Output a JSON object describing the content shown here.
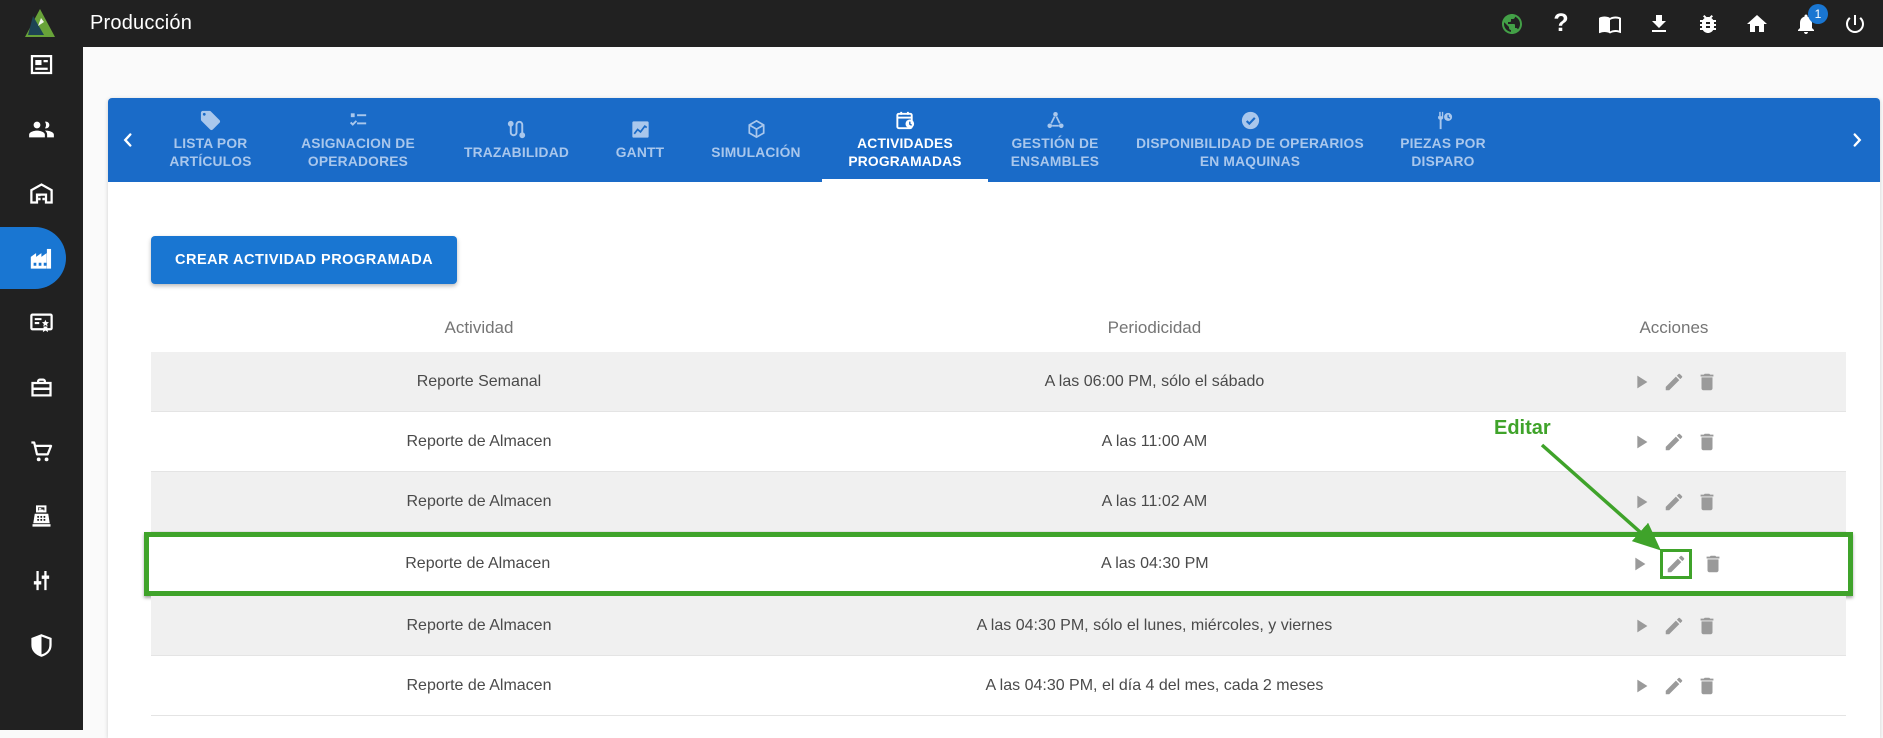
{
  "topbar": {
    "title": "Producción",
    "icons": [
      {
        "name": "globe-icon"
      },
      {
        "name": "help-icon"
      },
      {
        "name": "book-icon"
      },
      {
        "name": "download-icon"
      },
      {
        "name": "bug-icon"
      },
      {
        "name": "home-icon"
      },
      {
        "name": "notifications-icon",
        "badge": "1"
      },
      {
        "name": "power-icon"
      }
    ]
  },
  "sidebar": {
    "items": [
      {
        "name": "news",
        "icon": "newspaper-icon",
        "active": false
      },
      {
        "name": "staff",
        "icon": "people-icon",
        "active": false
      },
      {
        "name": "warehouse",
        "icon": "warehouse-icon",
        "active": false
      },
      {
        "name": "production",
        "icon": "factory-icon",
        "active": true
      },
      {
        "name": "quality",
        "icon": "certificate-icon",
        "active": false
      },
      {
        "name": "assets",
        "icon": "briefcase-icon",
        "active": false
      },
      {
        "name": "purchases",
        "icon": "cart-icon",
        "active": false
      },
      {
        "name": "pos",
        "icon": "cash-register-icon",
        "active": false
      },
      {
        "name": "configuration",
        "icon": "tune-icon",
        "active": false
      },
      {
        "name": "security",
        "icon": "shield-icon",
        "active": false
      }
    ]
  },
  "tabs": {
    "items": [
      {
        "label": "LISTA POR ARTÍCULOS",
        "icon": "tag-icon",
        "active": false
      },
      {
        "label": "ASIGNACION DE OPERADORES",
        "icon": "checklist-icon",
        "active": false
      },
      {
        "label": "TRAZABILIDAD",
        "icon": "route-icon",
        "active": false
      },
      {
        "label": "GANTT",
        "icon": "chart-icon",
        "active": false
      },
      {
        "label": "SIMULACIÓN",
        "icon": "cube-icon",
        "active": false
      },
      {
        "label": "ACTIVIDADES PROGRAMADAS",
        "icon": "calendar-clock-icon",
        "active": true
      },
      {
        "label": "GESTIÓN DE ENSAMBLES",
        "icon": "assembly-icon",
        "active": false
      },
      {
        "label": "DISPONIBILIDAD DE OPERARIOS EN MAQUINAS",
        "icon": "check-circle-icon",
        "active": false
      },
      {
        "label": "PIEZAS POR DISPARO",
        "icon": "wrench-clock-icon",
        "active": false
      }
    ]
  },
  "content": {
    "create_button": "CREAR ACTIVIDAD PROGRAMADA",
    "table": {
      "headers": [
        "Actividad",
        "Periodicidad",
        "Acciones"
      ],
      "row_actions": [
        "play-icon",
        "edit-icon",
        "delete-icon"
      ],
      "rows": [
        {
          "actividad": "Reporte Semanal",
          "periodicidad": "A las 06:00 PM, sólo el sábado",
          "highlighted": false
        },
        {
          "actividad": "Reporte de Almacen",
          "periodicidad": "A las 11:00 AM",
          "highlighted": false
        },
        {
          "actividad": "Reporte de Almacen",
          "periodicidad": "A las 11:02 AM",
          "highlighted": false
        },
        {
          "actividad": "Reporte de Almacen",
          "periodicidad": "A las 04:30 PM",
          "highlighted": true
        },
        {
          "actividad": "Reporte de Almacen",
          "periodicidad": "A las 04:30 PM, sólo el lunes, miércoles, y viernes",
          "highlighted": false
        },
        {
          "actividad": "Reporte de Almacen",
          "periodicidad": "A las 04:30 PM, el día 4 del mes, cada 2 meses",
          "highlighted": false
        }
      ]
    },
    "annotation": {
      "label": "Editar"
    }
  },
  "colors": {
    "topbar_bg": "#212121",
    "tabbar_blue": "#1a6bc8",
    "button_blue": "#1976d2",
    "annotation_green": "#3fa32a",
    "stripe_gray": "#f0f0f0"
  }
}
